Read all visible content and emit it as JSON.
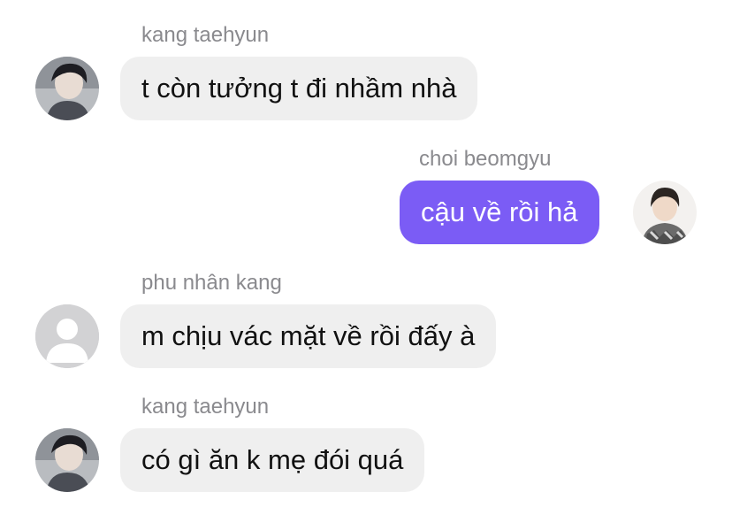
{
  "messages": [
    {
      "sender": "kang taehyun",
      "text": "t còn tưởng t đi nhầm nhà",
      "direction": "incoming",
      "avatar": "photo-avatar-icon"
    },
    {
      "sender": "choi beomgyu",
      "text": "cậu về rồi hả",
      "direction": "outgoing",
      "avatar": "photo-avatar-icon"
    },
    {
      "sender": "phu nhân kang",
      "text": "m chịu vác mặt về rồi đấy à",
      "direction": "incoming",
      "avatar": "default-user-icon"
    },
    {
      "sender": "kang taehyun",
      "text": "có gì ăn k mẹ đói quá",
      "direction": "incoming",
      "avatar": "photo-avatar-icon"
    }
  ],
  "colors": {
    "outgoing_bubble": "#7b5cf5",
    "incoming_bubble": "#efefef",
    "sender_name": "#8a8a8e"
  }
}
